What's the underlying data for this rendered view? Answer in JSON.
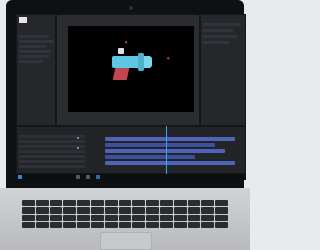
{
  "device": {
    "type": "laptop"
  },
  "screen": {
    "app": "video-editor",
    "viewer": {
      "artwork": "ray-gun"
    },
    "colors": {
      "gun_body": "#5ec7e3",
      "gun_grip": "#c44552",
      "viewer_bg": "#000000",
      "timeline_track": "#4f63b8",
      "playhead": "#3aa2ff"
    }
  },
  "icons": [
    "camera-icon",
    "windows-start-icon"
  ]
}
